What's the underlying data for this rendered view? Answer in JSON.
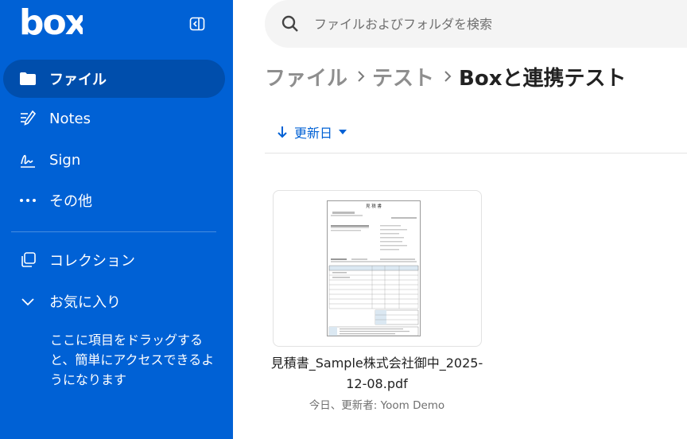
{
  "app": {
    "logo_text": "box",
    "colors": {
      "brand": "#0061d5",
      "sidebar_active": "#004eac",
      "text_primary": "#222222",
      "text_muted": "#8e8e8e"
    }
  },
  "sidebar": {
    "collapse_icon": "sidebar-collapse-icon",
    "items": [
      {
        "label": "ファイル",
        "icon": "folder-icon",
        "active": true
      },
      {
        "label": "Notes",
        "icon": "notes-icon",
        "active": false
      },
      {
        "label": "Sign",
        "icon": "sign-icon",
        "active": false
      },
      {
        "label": "その他",
        "icon": "more-icon",
        "active": false
      }
    ],
    "collections_label": "コレクション",
    "favorites_label": "お気に入り",
    "favorites_hint": "ここに項目をドラッグすると、簡単にアクセスできるようになります"
  },
  "search": {
    "placeholder": "ファイルおよびフォルダを検索",
    "icon": "search-icon"
  },
  "breadcrumb": {
    "items": [
      "ファイル",
      "テスト"
    ],
    "current": "Boxと連携テスト"
  },
  "sort": {
    "label": "更新日",
    "direction": "descending"
  },
  "files": [
    {
      "name": "見積書_Sample株式会社御中_2025-12-08.pdf",
      "meta": "今日、更新者: Yoom Demo",
      "preview_title": "見 積 書"
    }
  ]
}
